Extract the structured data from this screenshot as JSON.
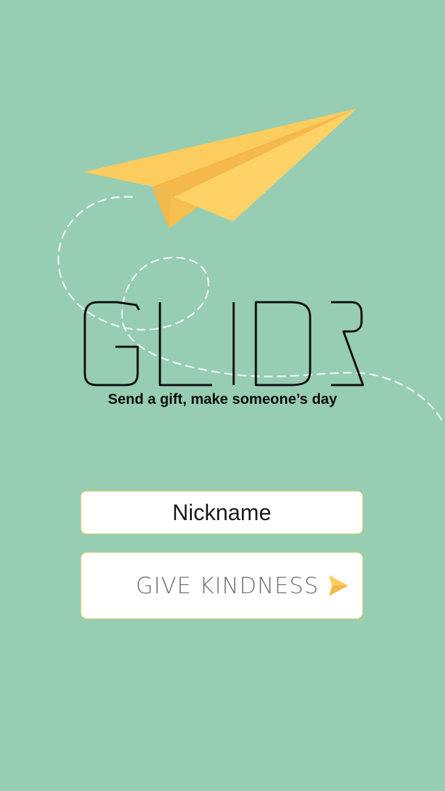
{
  "app": {
    "name": "GLIDR",
    "tagline": "Send a gift, make someone’s day"
  },
  "form": {
    "nickname_placeholder": "Nickname",
    "submit_label": "GIVE KINDNESS",
    "submit_icon": "paper-plane-arrow-icon"
  },
  "colors": {
    "background": "#96cdb3",
    "plane_yellow": "#fdcc5e",
    "plane_shadow": "#f1b84a",
    "field_border": "#f2d56f",
    "logo": "#0c0c0c",
    "button_text": "#6e6e6e"
  }
}
